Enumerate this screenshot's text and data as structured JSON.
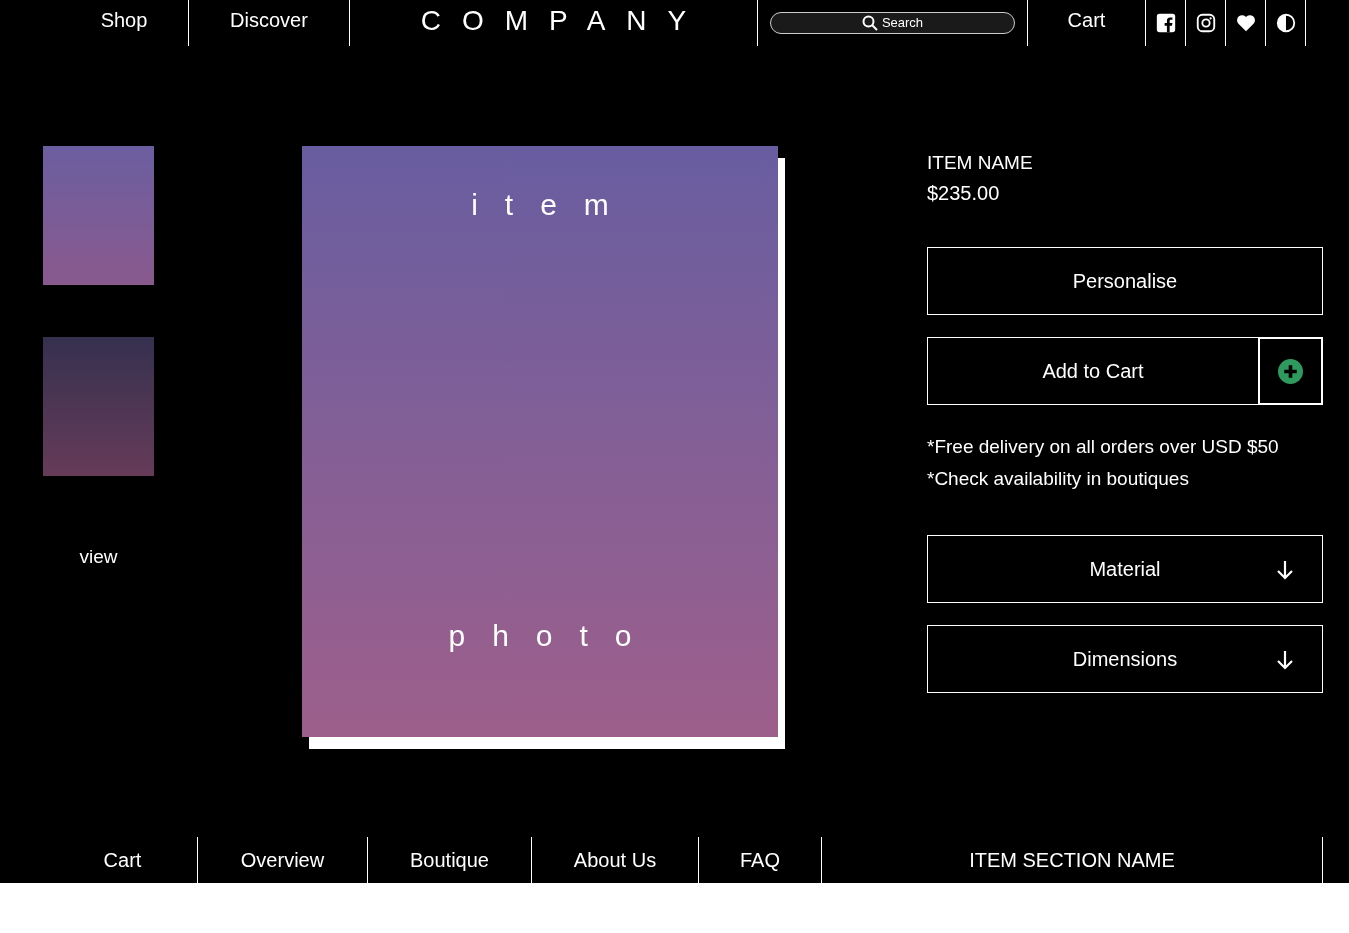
{
  "header": {
    "nav": [
      {
        "label": "Shop"
      },
      {
        "label": "Discover"
      }
    ],
    "logo": "COMPANY",
    "search": {
      "placeholder": "Search"
    },
    "cart": "Cart",
    "icons": [
      {
        "kind": "facebook"
      },
      {
        "kind": "instagram"
      },
      {
        "kind": "heart"
      },
      {
        "kind": "contrast"
      }
    ]
  },
  "gallery": {
    "thumbnails": [
      {
        "color": "#6b5ea0"
      },
      {
        "color": "#35304f"
      }
    ],
    "view_label": "view"
  },
  "photo": {
    "top_text": "item",
    "bottom_text": "photo",
    "color": "#685da0"
  },
  "product": {
    "name": "ITEM NAME",
    "price": "$235.00",
    "personalise": "Personalise",
    "add_to_cart": "Add to Cart",
    "notes": [
      "*Free delivery on all orders over USD $50",
      "*Check availability in boutiques"
    ],
    "dropdowns": [
      {
        "label": "Material",
        "expanded": false
      },
      {
        "label": "Dimensions",
        "expanded": false
      }
    ]
  },
  "footer": {
    "items": [
      {
        "label": "Cart"
      },
      {
        "label": "Overview"
      },
      {
        "label": "Boutique"
      },
      {
        "label": "About Us"
      },
      {
        "label": "FAQ"
      },
      {
        "label": "ITEM SECTION NAME"
      }
    ]
  }
}
